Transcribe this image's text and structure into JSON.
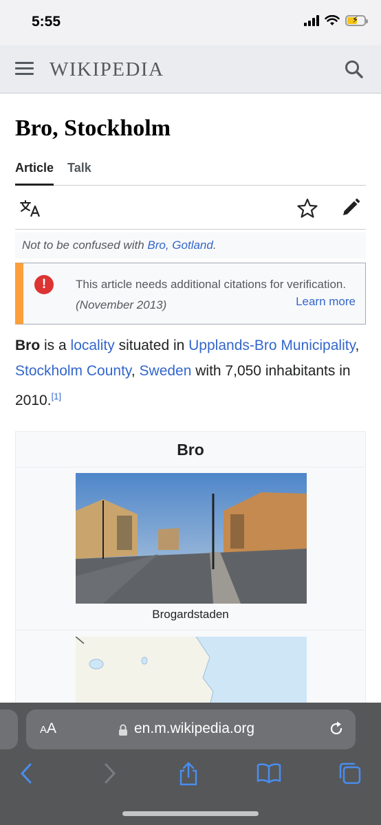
{
  "status_bar": {
    "time": "5:55",
    "battery_level": 0.6
  },
  "header": {
    "wordmark": "WIKIPEDIA",
    "menu_icon": "hamburger-icon",
    "search_icon": "search-icon"
  },
  "article": {
    "title": "Bro, Stockholm",
    "tabs": [
      {
        "label": "Article",
        "active": true
      },
      {
        "label": "Talk",
        "active": false
      }
    ],
    "toolbar": {
      "language_icon": "language-icon",
      "watch_icon": "star-icon",
      "edit_icon": "pencil-icon"
    },
    "hatnote": {
      "prefix": "Not to be confused with ",
      "link": "Bro, Gotland",
      "suffix": "."
    },
    "notice": {
      "icon": "!",
      "text": "This article needs additional citations for verification.",
      "date": "(November 2013)",
      "learn_more": "Learn more"
    },
    "lead": {
      "subject": "Bro",
      "t1": " is a ",
      "l1": "locality",
      "t2": " situated in ",
      "l2": "Upplands-Bro Municipality",
      "t3": ", ",
      "l3": "Stockholm County",
      "t4": ", ",
      "l4": "Sweden",
      "t5": " with 7,050 inhabitants in 2010.",
      "ref": "[1]"
    },
    "infobox": {
      "title": "Bro",
      "caption": "Brogardstaden"
    }
  },
  "browser": {
    "aa_small": "A",
    "aa_big": "A",
    "url": "en.m.wikipedia.org",
    "nav": [
      "back-icon",
      "forward-icon",
      "share-icon",
      "bookmarks-icon",
      "tabs-icon"
    ]
  },
  "colors": {
    "link": "#3366cc",
    "notice_border": "#fc9f3a",
    "notice_icon": "#d33333",
    "header_bg": "#eaecf0",
    "safari_bar": "#555759",
    "ios_blue": "#4a8ef0"
  }
}
